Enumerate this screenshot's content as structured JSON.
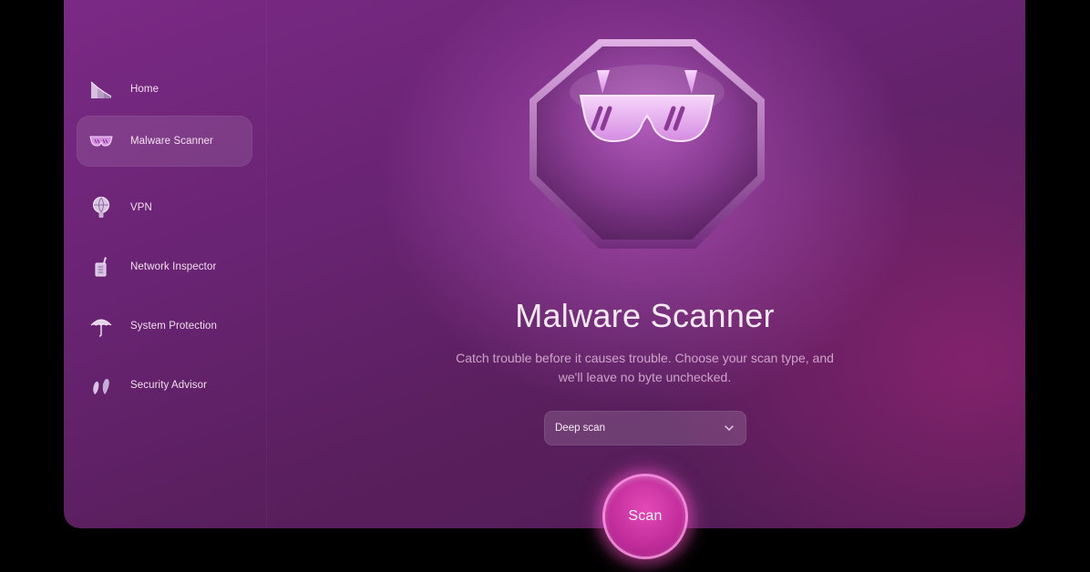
{
  "sidebar": {
    "items": [
      {
        "label": "Home",
        "icon": "home-icon",
        "active": false
      },
      {
        "label": "Malware Scanner",
        "icon": "sunglasses-icon",
        "active": true
      },
      {
        "label": "VPN",
        "icon": "vpn-icon",
        "active": false
      },
      {
        "label": "Network Inspector",
        "icon": "network-inspector-icon",
        "active": false
      },
      {
        "label": "System Protection",
        "icon": "umbrella-icon",
        "active": false
      },
      {
        "label": "Security Advisor",
        "icon": "security-advisor-icon",
        "active": false
      }
    ]
  },
  "main": {
    "hero_icon": "sunglasses-icon",
    "title": "Malware Scanner",
    "subtitle_line1": "Catch trouble before it causes trouble. Choose your scan type, and",
    "subtitle_line2": "we'll leave no byte unchecked.",
    "scan_type": {
      "selected": "Deep scan"
    },
    "scan_button_label": "Scan"
  },
  "colors": {
    "background": "#6a2474",
    "accent": "#c02c9a",
    "text": "#fbeaf7"
  }
}
